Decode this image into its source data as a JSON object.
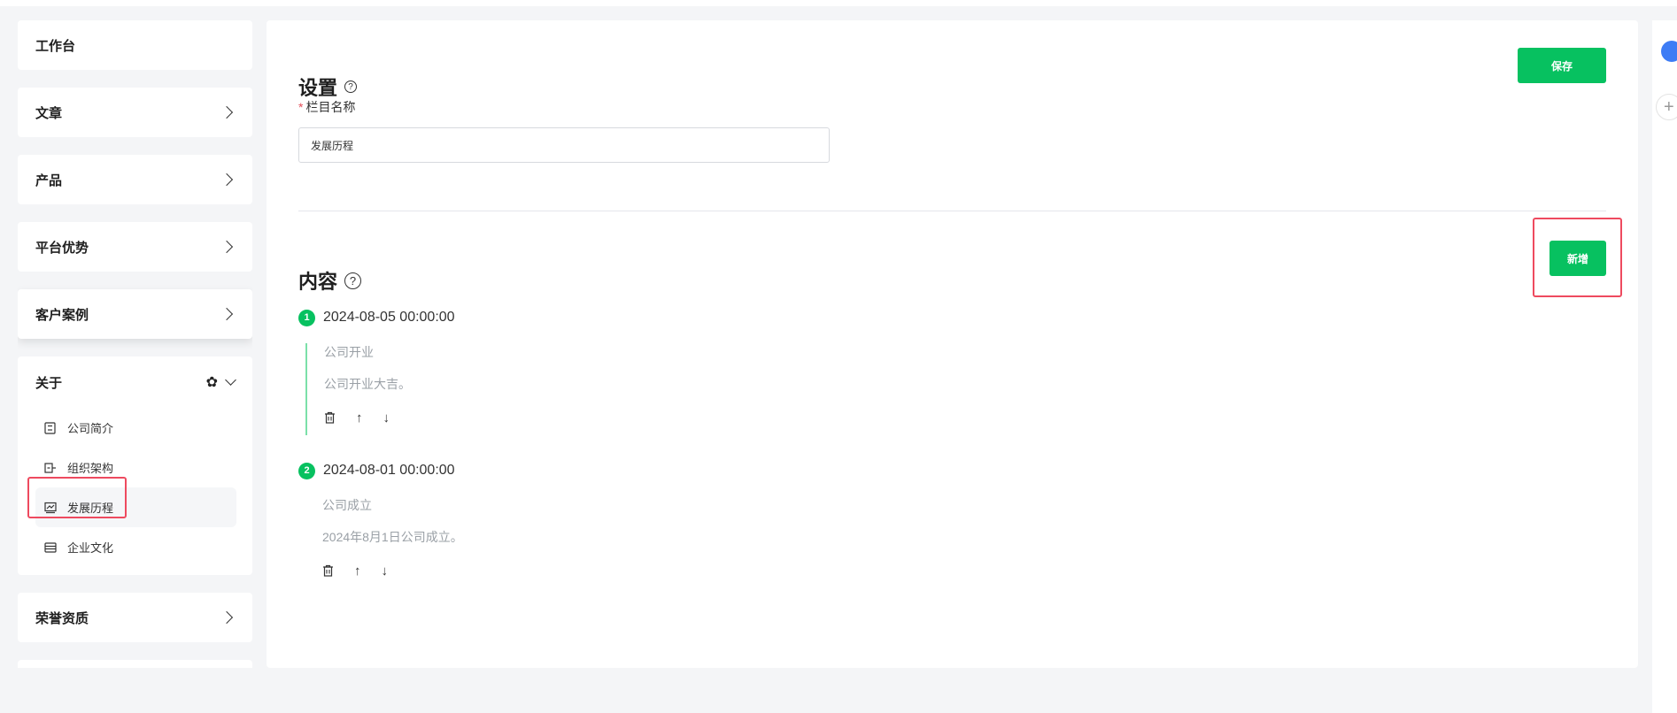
{
  "sidebar": {
    "items": [
      {
        "label": "工作台"
      },
      {
        "label": "文章"
      },
      {
        "label": "产品"
      },
      {
        "label": "平台优势"
      },
      {
        "label": "客户案例"
      }
    ],
    "group": {
      "label": "关于",
      "children": [
        {
          "label": "公司简介",
          "icon": "document-icon"
        },
        {
          "label": "组织架构",
          "icon": "org-chart-icon"
        },
        {
          "label": "发展历程",
          "icon": "history-icon"
        },
        {
          "label": "企业文化",
          "icon": "culture-icon"
        }
      ]
    },
    "after_items": [
      {
        "label": "荣誉资质"
      }
    ]
  },
  "settings": {
    "title": "设置",
    "help_icon": "help-circle-icon",
    "save_label": "保存",
    "field_label": "栏目名称",
    "required_mark": "*",
    "field_value": "发展历程"
  },
  "content": {
    "title": "内容",
    "help_icon": "help-circle-icon",
    "add_label": "新增",
    "timeline": [
      {
        "index": "1",
        "date": "2024-08-05 00:00:00",
        "title": "公司开业",
        "text": "公司开业大吉。"
      },
      {
        "index": "2",
        "date": "2024-08-01 00:00:00",
        "title": "公司成立",
        "text": "2024年8月1日公司成立。"
      }
    ]
  },
  "colors": {
    "accent": "#07c160",
    "highlight": "#ee4a5f",
    "timeline_line": "#7be0a9"
  }
}
